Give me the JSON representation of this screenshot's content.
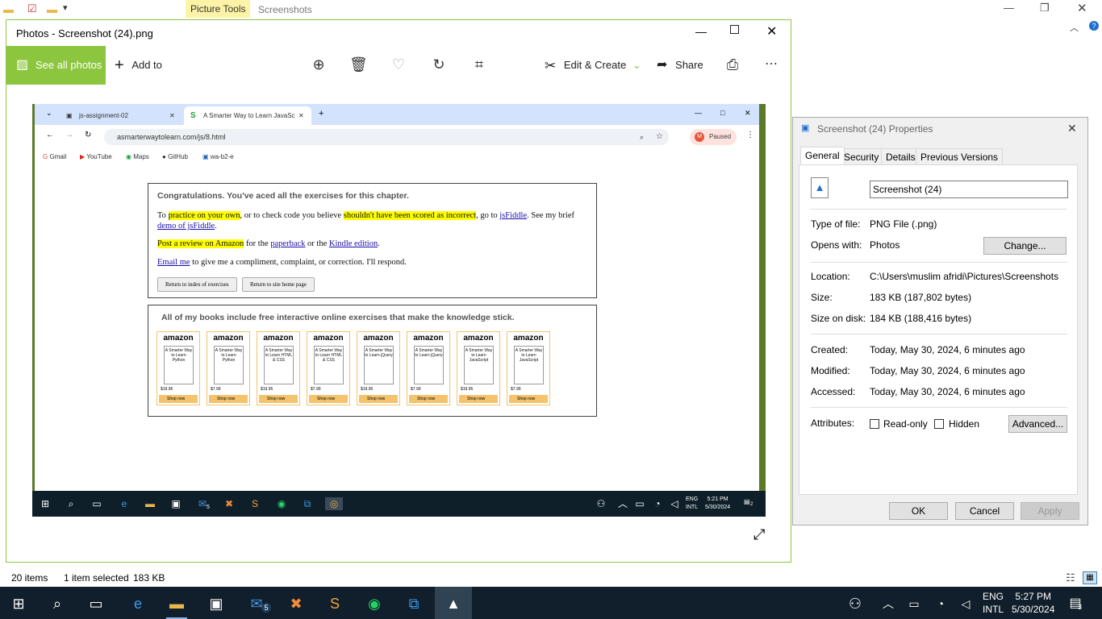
{
  "explorer": {
    "picture_tools": "Picture Tools",
    "title": "Screenshots",
    "status": {
      "items": "20 items",
      "selected": "1 item selected",
      "size": "183 KB"
    }
  },
  "photos": {
    "title": "Photos - Screenshot (24).png",
    "see_all": "See all photos",
    "add_to": "Add to",
    "edit_create": "Edit & Create",
    "share": "Share"
  },
  "browser": {
    "tab1": "js-assignment-02",
    "tab2": "A Smarter Way to Learn JavaSc",
    "url": "asmarterwaytolearn.com/js/8.html",
    "paused": "Paused",
    "bookmarks": [
      "Gmail",
      "YouTube",
      "Maps",
      "GitHub",
      "wa-b2-e"
    ]
  },
  "webpage": {
    "heading": "Congratulations. You've aced all the exercises for this chapter.",
    "p1_a": "To ",
    "p1_hl1": "practice on your own",
    "p1_b": ", or to check code you believe ",
    "p1_hl2": "shouldn't have been scored as incorrect",
    "p1_c": ", go to ",
    "p1_link1": "jsFiddle",
    "p1_d": ". See my brief ",
    "p1_link2": "demo of jsFiddle",
    "p1_e": ".",
    "p2_hl": "Post a review on Amazon",
    "p2_a": " for the ",
    "p2_link1": "paperback",
    "p2_b": " or the ",
    "p2_link2": "Kindle edition",
    "p2_c": ".",
    "p3_link": "Email me",
    "p3_a": " to give me a compliment, complaint, or correction. I'll respond.",
    "btn1": "Return to index of exercises",
    "btn2": "Return to site home page",
    "books_heading": "All of my books include free interactive online exercises that make the knowledge stick.",
    "books": [
      {
        "brand": "amazon",
        "title": "A Smarter Way to Learn Python",
        "price": "$19.95",
        "shop": "Shop now"
      },
      {
        "brand": "amazon",
        "title": "A Smarter Way to Learn Python",
        "price": "$7.99",
        "shop": "Shop now"
      },
      {
        "brand": "amazon",
        "title": "A Smarter Way to Learn HTML & CSS",
        "price": "$19.95",
        "shop": "Shop now"
      },
      {
        "brand": "amazon",
        "title": "A Smarter Way to Learn HTML & CSS",
        "price": "$7.99",
        "shop": "Shop now"
      },
      {
        "brand": "amazon",
        "title": "A Smarter Way to Learn jQuery",
        "price": "$19.95",
        "shop": "Shop now"
      },
      {
        "brand": "amazon",
        "title": "A Smarter Way to Learn jQuery",
        "price": "$7.99",
        "shop": "Shop now"
      },
      {
        "brand": "amazon",
        "title": "A Smarter Way to Learn JavaScript",
        "price": "$19.95",
        "shop": "Shop now"
      },
      {
        "brand": "amazon",
        "title": "A Smarter Way to Learn JavaScript",
        "price": "$7.99",
        "shop": "Shop now"
      }
    ]
  },
  "inner_taskbar": {
    "lang1": "ENG",
    "lang2": "INTL",
    "time": "5:21 PM",
    "date": "5/30/2024",
    "badge": "5",
    "notif": "2"
  },
  "properties": {
    "title": "Screenshot (24) Properties",
    "tabs": [
      "General",
      "Security",
      "Details",
      "Previous Versions"
    ],
    "name": "Screenshot (24)",
    "type_label": "Type of file:",
    "type_value": "PNG File (.png)",
    "opens_label": "Opens with:",
    "opens_value": "Photos",
    "change": "Change...",
    "location_label": "Location:",
    "location_value": "C:\\Users\\muslim afridi\\Pictures\\Screenshots",
    "size_label": "Size:",
    "size_value": "183 KB (187,802 bytes)",
    "disk_label": "Size on disk:",
    "disk_value": "184 KB (188,416 bytes)",
    "created_label": "Created:",
    "created_value": "Today, May 30, 2024, 6 minutes ago",
    "modified_label": "Modified:",
    "modified_value": "Today, May 30, 2024, 6 minutes ago",
    "accessed_label": "Accessed:",
    "accessed_value": "Today, May 30, 2024, 6 minutes ago",
    "attributes_label": "Attributes:",
    "readonly": "Read-only",
    "hidden": "Hidden",
    "advanced": "Advanced...",
    "ok": "OK",
    "cancel": "Cancel",
    "apply": "Apply"
  },
  "taskbar": {
    "lang1": "ENG",
    "lang2": "INTL",
    "time": "5:27 PM",
    "date": "5/30/2024",
    "mail_badge": "5",
    "notif": "3"
  },
  "colors": {
    "accent": "#8cc63f",
    "highlight": "#ffff00",
    "taskbar": "#101f2b"
  }
}
